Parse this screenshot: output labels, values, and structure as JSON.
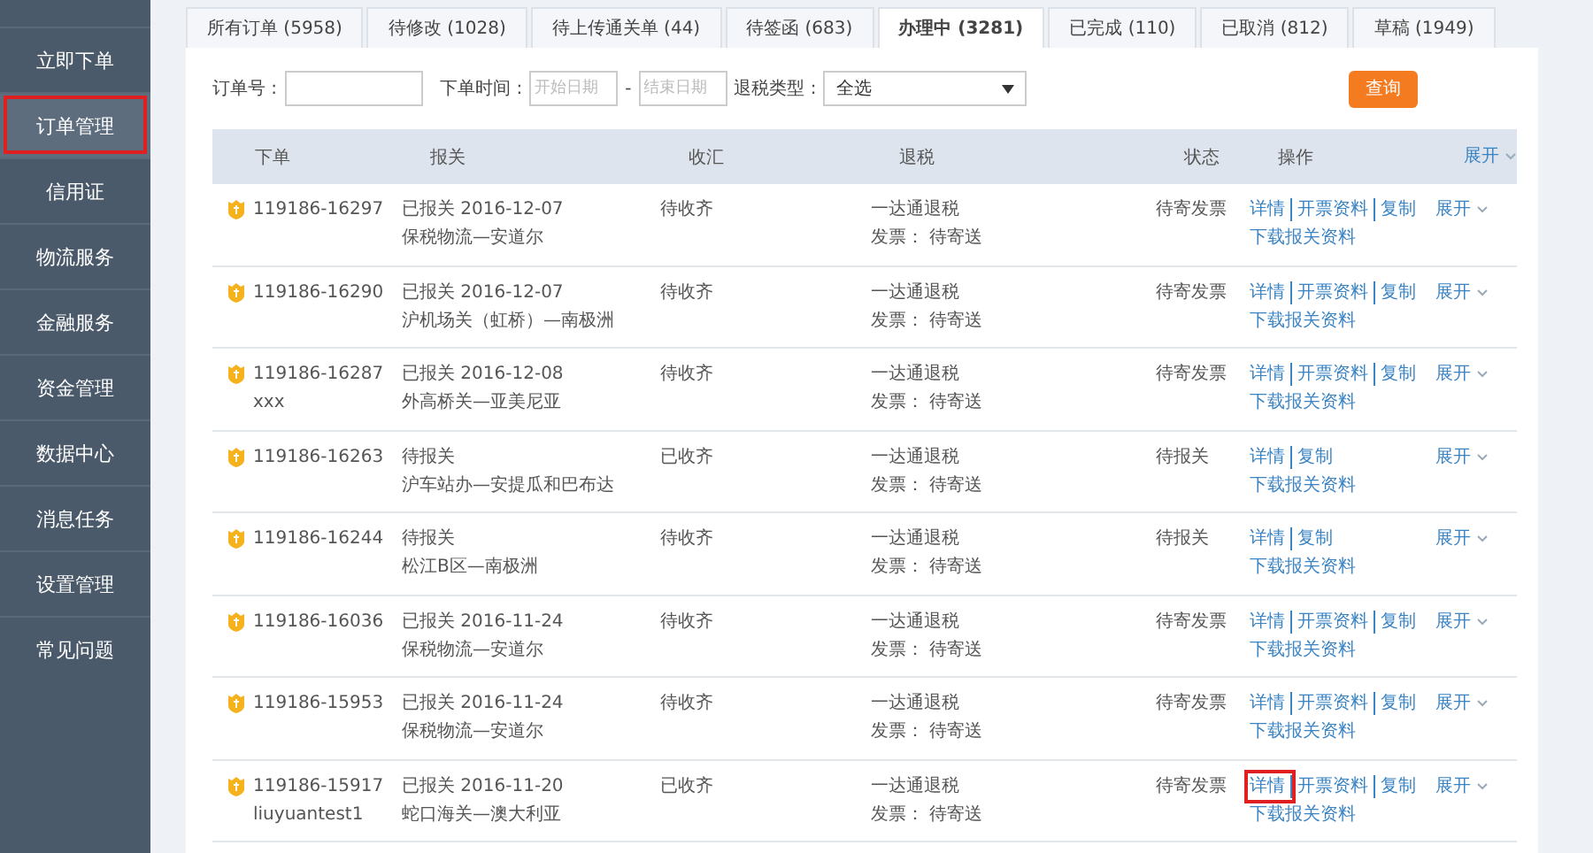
{
  "sidebar": {
    "items": [
      {
        "label": "立即下单",
        "selected": false,
        "highlighted": false
      },
      {
        "label": "订单管理",
        "selected": true,
        "highlighted": true
      },
      {
        "label": "信用证",
        "selected": false,
        "highlighted": false
      },
      {
        "label": "物流服务",
        "selected": false,
        "highlighted": false
      },
      {
        "label": "金融服务",
        "selected": false,
        "highlighted": false
      },
      {
        "label": "资金管理",
        "selected": false,
        "highlighted": false
      },
      {
        "label": "数据中心",
        "selected": false,
        "highlighted": false
      },
      {
        "label": "消息任务",
        "selected": false,
        "highlighted": false
      },
      {
        "label": "设置管理",
        "selected": false,
        "highlighted": false
      },
      {
        "label": "常见问题",
        "selected": false,
        "highlighted": false
      }
    ]
  },
  "tabs": [
    {
      "label": "所有订单 (5958)",
      "selected": false
    },
    {
      "label": "待修改 (1028)",
      "selected": false
    },
    {
      "label": "待上传通关单 (44)",
      "selected": false
    },
    {
      "label": "待签函 (683)",
      "selected": false
    },
    {
      "label": "办理中 (3281)",
      "selected": true
    },
    {
      "label": "已完成 (110)",
      "selected": false
    },
    {
      "label": "已取消 (812)",
      "selected": false
    },
    {
      "label": "草稿 (1949)",
      "selected": false
    }
  ],
  "filters": {
    "order_no_label": "订单号 :",
    "order_time_label": "下单时间 :",
    "start_placeholder": "开始日期",
    "range_dash": "-",
    "end_placeholder": "结束日期",
    "refund_type_label": "退税类型 :",
    "refund_type_value": "全选",
    "query_button": "查询"
  },
  "table": {
    "columns": [
      "下单",
      "报关",
      "收汇",
      "退税",
      "状态",
      "操作",
      "展开"
    ],
    "rows": [
      {
        "order": "119186-16297",
        "order_note": "",
        "customs": "已报关 2016-12-07",
        "route": "保税物流—安道尔",
        "remittance": "待收齐",
        "refund": "一达通退税",
        "invoice": "发票： 待寄送",
        "status": "待寄发票",
        "actions": [
          {
            "label": "详情",
            "highlighted": false
          },
          {
            "label": "开票资料",
            "highlighted": false
          },
          {
            "label": "复制",
            "highlighted": false
          }
        ],
        "download": "下载报关资料",
        "expand": "展开"
      },
      {
        "order": "119186-16290",
        "order_note": "",
        "customs": "已报关 2016-12-07",
        "route": "沪机场关（虹桥）—南极洲",
        "remittance": "待收齐",
        "refund": "一达通退税",
        "invoice": "发票： 待寄送",
        "status": "待寄发票",
        "actions": [
          {
            "label": "详情",
            "highlighted": false
          },
          {
            "label": "开票资料",
            "highlighted": false
          },
          {
            "label": "复制",
            "highlighted": false
          }
        ],
        "download": "下载报关资料",
        "expand": "展开"
      },
      {
        "order": "119186-16287",
        "order_note": "xxx",
        "customs": "已报关 2016-12-08",
        "route": "外高桥关—亚美尼亚",
        "remittance": "待收齐",
        "refund": "一达通退税",
        "invoice": "发票： 待寄送",
        "status": "待寄发票",
        "actions": [
          {
            "label": "详情",
            "highlighted": false
          },
          {
            "label": "开票资料",
            "highlighted": false
          },
          {
            "label": "复制",
            "highlighted": false
          }
        ],
        "download": "下载报关资料",
        "expand": "展开"
      },
      {
        "order": "119186-16263",
        "order_note": "",
        "customs": "待报关",
        "route": "沪车站办—安提瓜和巴布达",
        "remittance": "已收齐",
        "refund": "一达通退税",
        "invoice": "发票： 待寄送",
        "status": "待报关",
        "actions": [
          {
            "label": "详情",
            "highlighted": false
          },
          {
            "label": "复制",
            "highlighted": false
          }
        ],
        "download": "下载报关资料",
        "expand": "展开"
      },
      {
        "order": "119186-16244",
        "order_note": "",
        "customs": "待报关",
        "route": "松江B区—南极洲",
        "remittance": "待收齐",
        "refund": "一达通退税",
        "invoice": "发票： 待寄送",
        "status": "待报关",
        "actions": [
          {
            "label": "详情",
            "highlighted": false
          },
          {
            "label": "复制",
            "highlighted": false
          }
        ],
        "download": "下载报关资料",
        "expand": "展开"
      },
      {
        "order": "119186-16036",
        "order_note": "",
        "customs": "已报关 2016-11-24",
        "route": "保税物流—安道尔",
        "remittance": "待收齐",
        "refund": "一达通退税",
        "invoice": "发票： 待寄送",
        "status": "待寄发票",
        "actions": [
          {
            "label": "详情",
            "highlighted": false
          },
          {
            "label": "开票资料",
            "highlighted": false
          },
          {
            "label": "复制",
            "highlighted": false
          }
        ],
        "download": "下载报关资料",
        "expand": "展开"
      },
      {
        "order": "119186-15953",
        "order_note": "",
        "customs": "已报关 2016-11-24",
        "route": "保税物流—安道尔",
        "remittance": "待收齐",
        "refund": "一达通退税",
        "invoice": "发票： 待寄送",
        "status": "待寄发票",
        "actions": [
          {
            "label": "详情",
            "highlighted": false
          },
          {
            "label": "开票资料",
            "highlighted": false
          },
          {
            "label": "复制",
            "highlighted": false
          }
        ],
        "download": "下载报关资料",
        "expand": "展开"
      },
      {
        "order": "119186-15917",
        "order_note": "liuyuantest1",
        "customs": "已报关 2016-11-20",
        "route": "蛇口海关—澳大利亚",
        "remittance": "已收齐",
        "refund": "一达通退税",
        "invoice": "发票： 待寄送",
        "status": "待寄发票",
        "actions": [
          {
            "label": "详情",
            "highlighted": true
          },
          {
            "label": "开票资料",
            "highlighted": false
          },
          {
            "label": "复制",
            "highlighted": false
          }
        ],
        "download": "下载报关资料",
        "expand": "展开"
      }
    ]
  }
}
